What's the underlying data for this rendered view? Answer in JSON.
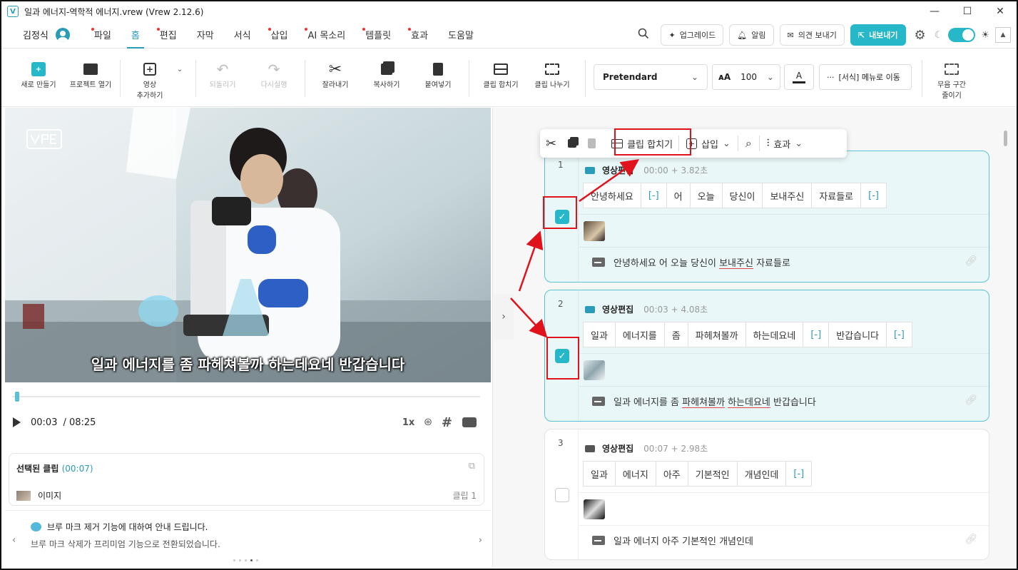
{
  "window": {
    "title": "일과 에너지-역학적 에너지.vrew (Vrew 2.12.6)",
    "app_icon": "V"
  },
  "menubar": {
    "user_name": "김정식",
    "items": [
      {
        "label": "파일",
        "dot": true
      },
      {
        "label": "홈",
        "dot": false,
        "active": true
      },
      {
        "label": "편집",
        "dot": true
      },
      {
        "label": "자막",
        "dot": false
      },
      {
        "label": "서식",
        "dot": false
      },
      {
        "label": "삽입",
        "dot": true
      },
      {
        "label": "AI 목소리",
        "dot": true
      },
      {
        "label": "템플릿",
        "dot": true
      },
      {
        "label": "효과",
        "dot": true
      },
      {
        "label": "도움말",
        "dot": false
      }
    ],
    "upgrade": "업그레이드",
    "notifications": "알림",
    "feedback": "의견 보내기",
    "export": "내보내기"
  },
  "toolbar": {
    "new": "새로 만들기",
    "open": "프로젝트 열기",
    "add_video_1": "영상",
    "add_video_2": "추가하기",
    "undo": "되돌리기",
    "redo": "다시실행",
    "cut": "잘라내기",
    "copy": "복사하기",
    "paste": "붙여넣기",
    "merge": "클립 합치기",
    "split": "클립 나누기",
    "font": "Pretendard",
    "size": "100",
    "color_label": "A",
    "more": "[서식] 메뉴로 이동",
    "silence_1": "무음 구간",
    "silence_2": "줄이기"
  },
  "player": {
    "subtitle": "일과 에너지를 좀 파헤쳐볼까 하는데요네 반갑습니다",
    "current_time": "00:03",
    "total_time": "/ 08:25",
    "speed": "1x",
    "progress": 0.006
  },
  "selected": {
    "title": "선택된 클립",
    "time": "(00:07)",
    "item": "이미지",
    "clip": "클립 1"
  },
  "notice": {
    "title": "브루 마크 제거 기능에 대하여 안내 드립니다.",
    "body": "브루 마크 삭제가 프리미엄 기능으로 전환되었습니다."
  },
  "context_bar": {
    "merge": "클립 합치기",
    "insert": "삽입",
    "effects": "효과"
  },
  "clips": [
    {
      "number": "1",
      "label": "영상편집",
      "time": "00:00 + 3.82초",
      "checked": true,
      "words": [
        "안녕하세요",
        "[-]",
        "어",
        "오늘",
        "당신이",
        "보내주신",
        "자료들로",
        "[-]"
      ],
      "subtitle_parts": [
        "안녕하세요 어 오늘 당신이 ",
        "보내주신",
        " 자료들로"
      ]
    },
    {
      "number": "2",
      "label": "영상편집",
      "time": "00:03 + 4.08초",
      "checked": true,
      "words": [
        "일과",
        "에너지를",
        "좀",
        "파헤쳐볼까",
        "하는데요네",
        "[-]",
        "반갑습니다",
        "[-]"
      ],
      "subtitle_parts": [
        "일과 에너지를 좀 ",
        "파헤쳐볼까",
        " ",
        "하는데요네",
        " 반갑습니다"
      ]
    },
    {
      "number": "3",
      "label": "영상편집",
      "time": "00:07 + 2.98초",
      "checked": false,
      "words": [
        "일과",
        "에너지",
        "아주",
        "기본적인",
        "개념인데",
        "[-]"
      ],
      "subtitle": "일과 에너지 아주 기본적인 개념인데"
    }
  ],
  "colors": {
    "accent": "#26b7c9",
    "highlight": "#e0121b"
  }
}
